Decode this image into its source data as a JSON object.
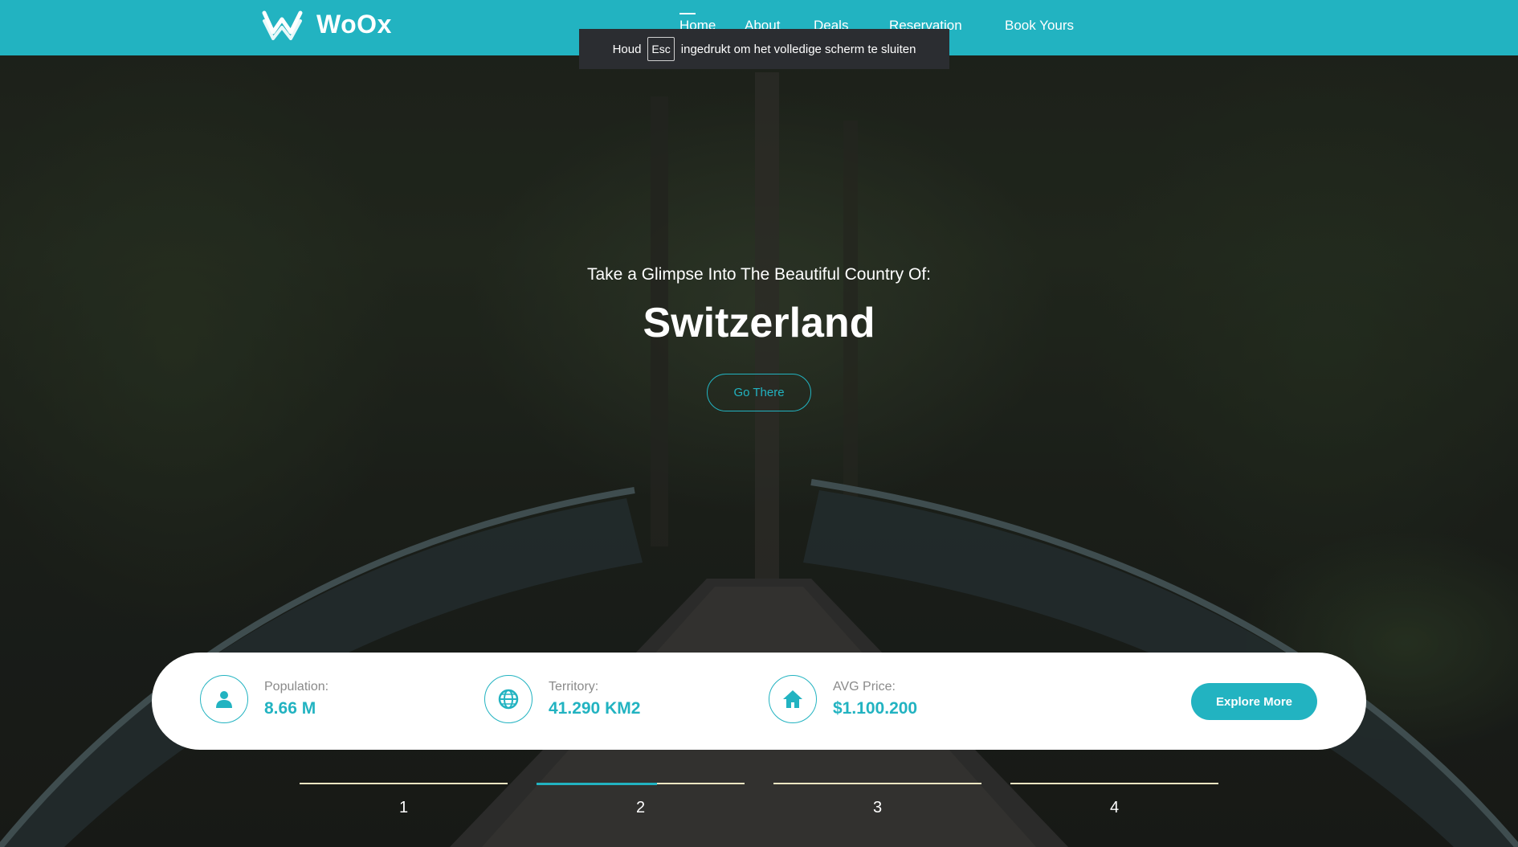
{
  "brand": {
    "name": "WoOx"
  },
  "nav": {
    "items": [
      {
        "label": "Home",
        "active": true
      },
      {
        "label": "About",
        "active": false
      },
      {
        "label": "Deals",
        "active": false
      },
      {
        "label": "Reservation",
        "active": false
      },
      {
        "label": "Book Yours",
        "active": false
      }
    ]
  },
  "fullscreen_notice": {
    "before": "Houd",
    "key": "Esc",
    "after": "ingedrukt om het volledige scherm te sluiten"
  },
  "hero": {
    "subtitle": "Take a Glimpse Into The Beautiful Country Of:",
    "title": "Switzerland",
    "cta_label": "Go There"
  },
  "stats": [
    {
      "icon": "user-icon",
      "label": "Population:",
      "value": "8.66 M"
    },
    {
      "icon": "globe-icon",
      "label": "Territory:",
      "value": "41.290 KM2"
    },
    {
      "icon": "home-icon",
      "label": "AVG Price:",
      "value": "$1.100.200"
    }
  ],
  "explore_label": "Explore More",
  "slider": {
    "items": [
      "1",
      "2",
      "3",
      "4"
    ],
    "active_index": 1,
    "active_progress": 0.58
  },
  "colors": {
    "accent": "#22b3c1",
    "card": "#ffffff",
    "line": "#f1e6c2"
  }
}
